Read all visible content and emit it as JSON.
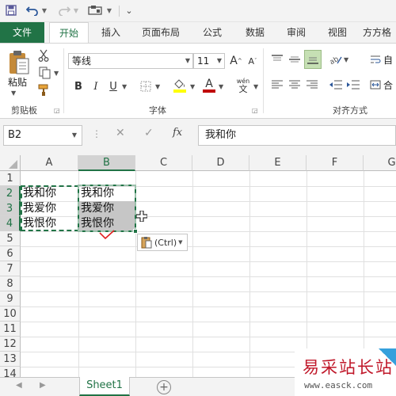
{
  "qat": {
    "save_icon": "save-icon",
    "undo_icon": "undo-icon",
    "redo_icon": "redo-icon"
  },
  "tabs": [
    {
      "label": "文件"
    },
    {
      "label": "开始"
    },
    {
      "label": "插入"
    },
    {
      "label": "页面布局"
    },
    {
      "label": "公式"
    },
    {
      "label": "数据"
    },
    {
      "label": "审阅"
    },
    {
      "label": "视图"
    },
    {
      "label": "方方格"
    }
  ],
  "ribbon": {
    "clipboard": {
      "paste_label": "粘贴",
      "group_label": "剪贴板"
    },
    "font": {
      "font_name": "等线",
      "font_size": "11",
      "group_label": "字体",
      "bold": "B",
      "italic": "I",
      "underline": "U",
      "font_grow": "A",
      "font_shrink": "A",
      "font_color_glyph": "A",
      "phonetic": "wén"
    },
    "alignment": {
      "group_label": "对齐方式",
      "wrap_label": "自",
      "merge_label": "合"
    }
  },
  "formula_bar": {
    "name_box": "B2",
    "cancel": "✕",
    "enter": "✓",
    "fx": "fx",
    "content": "我和你"
  },
  "grid": {
    "columns": [
      "A",
      "B",
      "C",
      "D",
      "E",
      "F",
      "G"
    ],
    "rows": [
      "1",
      "2",
      "3",
      "4",
      "5",
      "6",
      "7",
      "8",
      "9",
      "10",
      "11",
      "12",
      "13",
      "14"
    ],
    "cells": {
      "A2": "我和你",
      "A3": "我爱你",
      "A4": "我恨你",
      "B2": "我和你",
      "B3": "我爱你",
      "B4": "我恨你"
    },
    "paste_options_label": "(Ctrl)"
  },
  "sheets": {
    "active": "Sheet1",
    "add": "+"
  },
  "watermark": {
    "text": "易采站长站",
    "url": "www.easck.com"
  },
  "colors": {
    "accent": "#217346",
    "selection": "#c6c6c6"
  }
}
